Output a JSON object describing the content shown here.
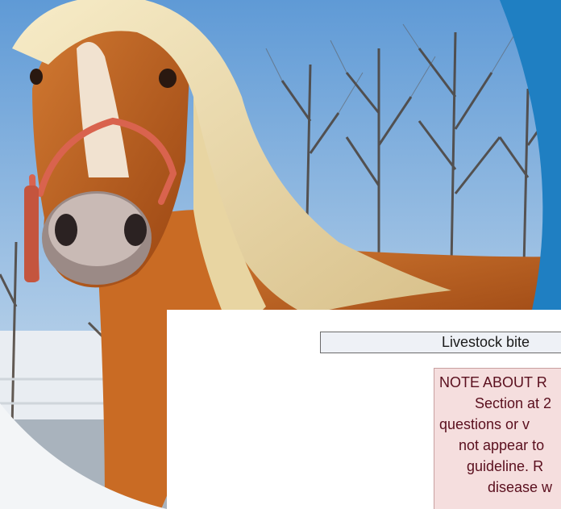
{
  "document": {
    "header_text": "Livestock bite",
    "note_lines": [
      "NOTE ABOUT R",
      "Section at 2",
      "questions or v",
      "not appear to",
      "guideline. R",
      "disease w"
    ]
  },
  "colors": {
    "sky": "#7fb0e2",
    "horse_coat": "#c6661f",
    "mane": "#eddcae",
    "halter": "#d9634e",
    "accent_blue": "#1f7fc2",
    "panel": "#ffffff",
    "note_bg": "#f5dede",
    "note_text": "#5a0f1e"
  }
}
